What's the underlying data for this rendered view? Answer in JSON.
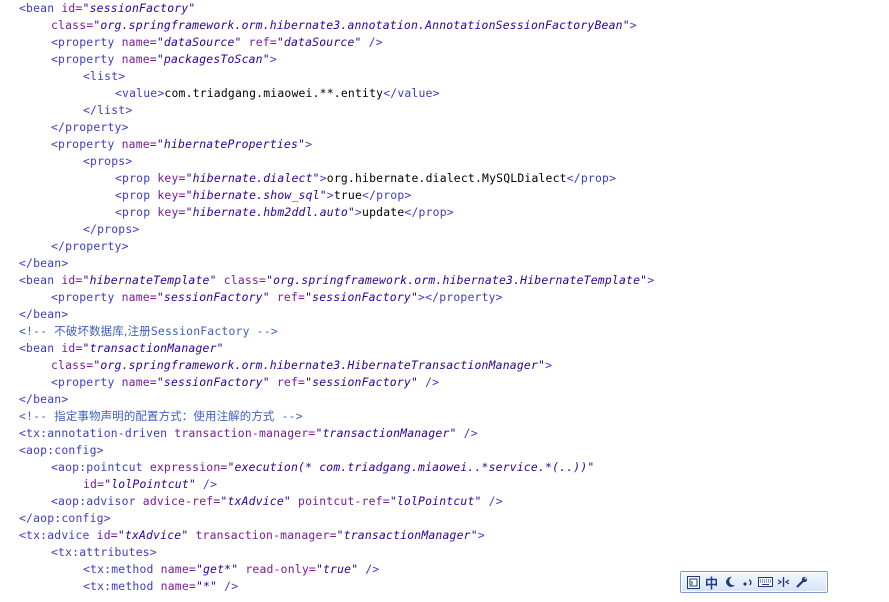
{
  "code_lines": [
    {
      "indent": 0,
      "tokens": [
        {
          "t": "tag",
          "s": "<bean "
        },
        {
          "t": "attr",
          "s": "id="
        },
        {
          "t": "val",
          "s": "\"sessionFactory\""
        }
      ]
    },
    {
      "indent": 1,
      "tokens": [
        {
          "t": "attr",
          "s": "class="
        },
        {
          "t": "val",
          "s": "\"org.springframework.orm.hibernate3.annotation.AnnotationSessionFactoryBean\""
        },
        {
          "t": "tag",
          "s": ">"
        }
      ]
    },
    {
      "indent": 1,
      "tokens": [
        {
          "t": "tag",
          "s": "<property "
        },
        {
          "t": "attr",
          "s": "name="
        },
        {
          "t": "val",
          "s": "\"dataSource\""
        },
        {
          "t": "tag",
          "s": " "
        },
        {
          "t": "attr",
          "s": "ref="
        },
        {
          "t": "val",
          "s": "\"dataSource\""
        },
        {
          "t": "tag",
          "s": " />"
        }
      ]
    },
    {
      "indent": 1,
      "tokens": [
        {
          "t": "tag",
          "s": "<property "
        },
        {
          "t": "attr",
          "s": "name="
        },
        {
          "t": "val",
          "s": "\"packagesToScan\""
        },
        {
          "t": "tag",
          "s": ">"
        }
      ]
    },
    {
      "indent": 2,
      "tokens": [
        {
          "t": "tag",
          "s": "<list>"
        }
      ]
    },
    {
      "indent": 3,
      "tokens": [
        {
          "t": "tag",
          "s": "<value>"
        },
        {
          "t": "text",
          "s": "com.triadgang.miaowei.**.entity"
        },
        {
          "t": "tag",
          "s": "</value>"
        }
      ]
    },
    {
      "indent": 2,
      "tokens": [
        {
          "t": "tag",
          "s": "</list>"
        }
      ]
    },
    {
      "indent": 1,
      "tokens": [
        {
          "t": "tag",
          "s": "</property>"
        }
      ]
    },
    {
      "indent": 1,
      "tokens": [
        {
          "t": "tag",
          "s": "<property "
        },
        {
          "t": "attr",
          "s": "name="
        },
        {
          "t": "val",
          "s": "\"hibernateProperties\""
        },
        {
          "t": "tag",
          "s": ">"
        }
      ]
    },
    {
      "indent": 2,
      "tokens": [
        {
          "t": "tag",
          "s": "<props>"
        }
      ]
    },
    {
      "indent": 3,
      "tokens": [
        {
          "t": "tag",
          "s": "<prop "
        },
        {
          "t": "attr",
          "s": "key="
        },
        {
          "t": "val",
          "s": "\"hibernate.dialect\""
        },
        {
          "t": "tag",
          "s": ">"
        },
        {
          "t": "text",
          "s": "org.hibernate.dialect.MySQLDialect"
        },
        {
          "t": "tag",
          "s": "</prop>"
        }
      ]
    },
    {
      "indent": 3,
      "tokens": [
        {
          "t": "tag",
          "s": "<prop "
        },
        {
          "t": "attr",
          "s": "key="
        },
        {
          "t": "val",
          "s": "\"hibernate.show_sql\""
        },
        {
          "t": "tag",
          "s": ">"
        },
        {
          "t": "text",
          "s": "true"
        },
        {
          "t": "tag",
          "s": "</prop>"
        }
      ]
    },
    {
      "indent": 3,
      "tokens": [
        {
          "t": "tag",
          "s": "<prop "
        },
        {
          "t": "attr",
          "s": "key="
        },
        {
          "t": "val",
          "s": "\"hibernate.hbm2ddl.auto\""
        },
        {
          "t": "tag",
          "s": ">"
        },
        {
          "t": "text",
          "s": "update"
        },
        {
          "t": "tag",
          "s": "</prop>"
        }
      ]
    },
    {
      "indent": 2,
      "tokens": [
        {
          "t": "tag",
          "s": "</props>"
        }
      ]
    },
    {
      "indent": 1,
      "tokens": [
        {
          "t": "tag",
          "s": "</property>"
        }
      ]
    },
    {
      "indent": 0,
      "tokens": [
        {
          "t": "tag",
          "s": "</bean>"
        }
      ]
    },
    {
      "indent": 0,
      "tokens": [
        {
          "t": "tag",
          "s": "<bean "
        },
        {
          "t": "attr",
          "s": "id="
        },
        {
          "t": "val",
          "s": "\"hibernateTemplate\""
        },
        {
          "t": "tag",
          "s": " "
        },
        {
          "t": "attr",
          "s": "class="
        },
        {
          "t": "val",
          "s": "\"org.springframework.orm.hibernate3.HibernateTemplate\""
        },
        {
          "t": "tag",
          "s": ">"
        }
      ]
    },
    {
      "indent": 1,
      "tokens": [
        {
          "t": "tag",
          "s": "<property "
        },
        {
          "t": "attr",
          "s": "name="
        },
        {
          "t": "val",
          "s": "\"sessionFactory\""
        },
        {
          "t": "tag",
          "s": " "
        },
        {
          "t": "attr",
          "s": "ref="
        },
        {
          "t": "val",
          "s": "\"sessionFactory\""
        },
        {
          "t": "tag",
          "s": "></property>"
        }
      ]
    },
    {
      "indent": 0,
      "tokens": [
        {
          "t": "tag",
          "s": "</bean>"
        }
      ]
    },
    {
      "indent": 0,
      "tokens": [
        {
          "t": "comment",
          "s": "<!-- "
        },
        {
          "t": "comment-cjk",
          "s": "不破坏数据库,注册"
        },
        {
          "t": "comment",
          "s": "SessionFactory -->"
        }
      ]
    },
    {
      "indent": 0,
      "tokens": [
        {
          "t": "tag",
          "s": "<bean "
        },
        {
          "t": "attr",
          "s": "id="
        },
        {
          "t": "val",
          "s": "\"transactionManager\""
        }
      ]
    },
    {
      "indent": 1,
      "tokens": [
        {
          "t": "attr",
          "s": "class="
        },
        {
          "t": "val",
          "s": "\"org.springframework.orm.hibernate3.HibernateTransactionManager\""
        },
        {
          "t": "tag",
          "s": ">"
        }
      ]
    },
    {
      "indent": 1,
      "tokens": [
        {
          "t": "tag",
          "s": "<property "
        },
        {
          "t": "attr",
          "s": "name="
        },
        {
          "t": "val",
          "s": "\"sessionFactory\""
        },
        {
          "t": "tag",
          "s": " "
        },
        {
          "t": "attr",
          "s": "ref="
        },
        {
          "t": "val",
          "s": "\"sessionFactory\""
        },
        {
          "t": "tag",
          "s": " />"
        }
      ]
    },
    {
      "indent": 0,
      "tokens": [
        {
          "t": "tag",
          "s": "</bean>"
        }
      ]
    },
    {
      "indent": 0,
      "tokens": [
        {
          "t": "comment",
          "s": "<!-- "
        },
        {
          "t": "comment-cjk",
          "s": "指定事物声明的配置方式：使用注解的方式"
        },
        {
          "t": "comment",
          "s": " -->"
        }
      ]
    },
    {
      "indent": 0,
      "tokens": [
        {
          "t": "tag",
          "s": "<tx:annotation-driven "
        },
        {
          "t": "attr",
          "s": "transaction-manager="
        },
        {
          "t": "val",
          "s": "\"transactionManager\""
        },
        {
          "t": "tag",
          "s": " />"
        }
      ]
    },
    {
      "indent": 0,
      "tokens": [
        {
          "t": "tag",
          "s": "<aop:config>"
        }
      ]
    },
    {
      "indent": 1,
      "tokens": [
        {
          "t": "tag",
          "s": "<aop:pointcut "
        },
        {
          "t": "attr",
          "s": "expression="
        },
        {
          "t": "val",
          "s": "\"execution(* com.triadgang.miaowei..*service.*(..))\""
        }
      ]
    },
    {
      "indent": 2,
      "tokens": [
        {
          "t": "attr",
          "s": "id="
        },
        {
          "t": "val",
          "s": "\"lolPointcut\""
        },
        {
          "t": "tag",
          "s": " />"
        }
      ]
    },
    {
      "indent": 1,
      "tokens": [
        {
          "t": "tag",
          "s": "<aop:advisor "
        },
        {
          "t": "attr",
          "s": "advice-ref="
        },
        {
          "t": "val",
          "s": "\"txAdvice\""
        },
        {
          "t": "tag",
          "s": " "
        },
        {
          "t": "attr",
          "s": "pointcut-ref="
        },
        {
          "t": "val",
          "s": "\"lolPointcut\""
        },
        {
          "t": "tag",
          "s": " />"
        }
      ]
    },
    {
      "indent": 0,
      "tokens": [
        {
          "t": "tag",
          "s": "</aop:config>"
        }
      ]
    },
    {
      "indent": 0,
      "tokens": [
        {
          "t": "tag",
          "s": "<tx:advice "
        },
        {
          "t": "attr",
          "s": "id="
        },
        {
          "t": "val",
          "s": "\"txAdvice\""
        },
        {
          "t": "tag",
          "s": " "
        },
        {
          "t": "attr",
          "s": "transaction-manager="
        },
        {
          "t": "val",
          "s": "\"transactionManager\""
        },
        {
          "t": "tag",
          "s": ">"
        }
      ]
    },
    {
      "indent": 1,
      "tokens": [
        {
          "t": "tag",
          "s": "<tx:attributes>"
        }
      ]
    },
    {
      "indent": 2,
      "tokens": [
        {
          "t": "tag",
          "s": "<tx:method "
        },
        {
          "t": "attr",
          "s": "name="
        },
        {
          "t": "val",
          "s": "\"get*\""
        },
        {
          "t": "tag",
          "s": " "
        },
        {
          "t": "attr",
          "s": "read-only="
        },
        {
          "t": "val",
          "s": "\"true\""
        },
        {
          "t": "tag",
          "s": " />"
        }
      ]
    },
    {
      "indent": 2,
      "tokens": [
        {
          "t": "tag",
          "s": "<tx:method "
        },
        {
          "t": "attr",
          "s": "name="
        },
        {
          "t": "val",
          "s": "\"*\""
        },
        {
          "t": "tag",
          "s": " />"
        }
      ]
    }
  ],
  "ime_toolbar": {
    "mode_label": "中",
    "colors": {
      "border": "#7f9cc7",
      "icon": "#203a78"
    },
    "icons": [
      "ime-logo-icon",
      "moon-icon",
      "punctuation-icon",
      "keyboard-icon",
      "fullwidth-icon",
      "wrench-icon"
    ]
  },
  "colors": {
    "tag": "#3c3cc8",
    "attr": "#7a1a9a",
    "value": "#2a00a0",
    "text": "#000000",
    "comment": "#3f5fbf",
    "background": "#ffffff"
  }
}
